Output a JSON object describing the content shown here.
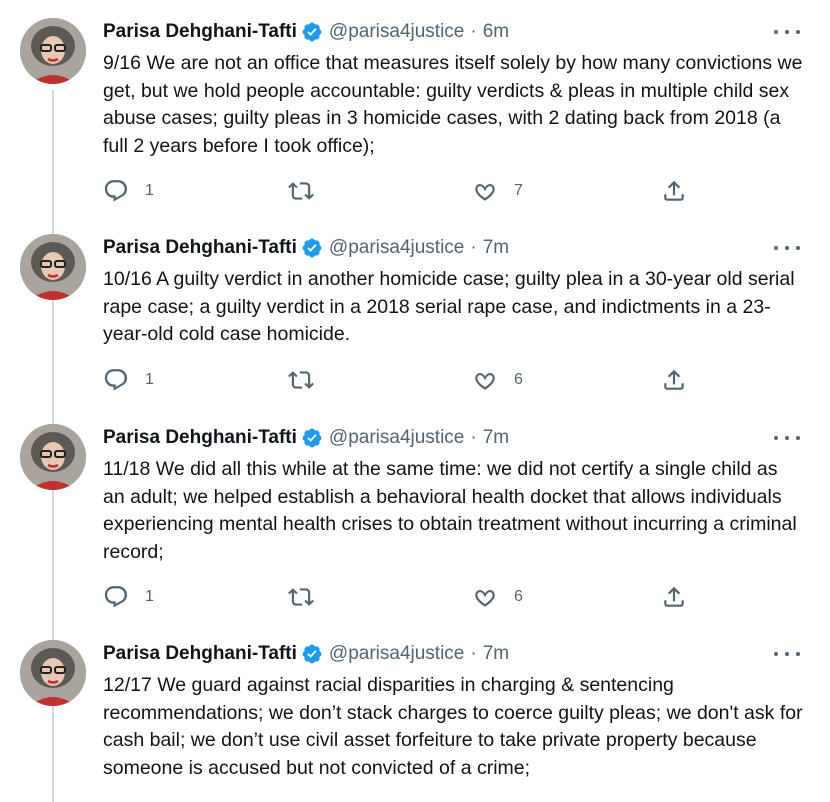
{
  "author": {
    "name": "Parisa Dehghani-Tafti",
    "handle": "@parisa4justice",
    "separator": "·"
  },
  "colors": {
    "verified": "#1d9bf0",
    "secondary_text": "#536471",
    "thread_line": "#cfd9de"
  },
  "icons": [
    "verified-badge-icon",
    "more-icon",
    "reply-icon",
    "retweet-icon",
    "like-icon",
    "share-icon"
  ],
  "tweets": [
    {
      "time": "6m",
      "text": "9/16 We are not an office that measures itself solely by how many convictions we get, but we hold people accountable: guilty verdicts & pleas in multiple child sex abuse cases; guilty pleas in 3 homicide cases, with 2 dating back from 2018 (a full 2 years before I took office);",
      "replies": "1",
      "retweets": "",
      "likes": "7"
    },
    {
      "time": "7m",
      "text": "10/16 A guilty verdict in another homicide case; guilty plea in a 30-year old serial rape case; a guilty verdict in a 2018 serial rape case, and indictments in a 23-year-old cold case homicide.",
      "replies": "1",
      "retweets": "",
      "likes": "6"
    },
    {
      "time": "7m",
      "text": "11/18 We did all this while at the same time: we did not certify a single child as an adult; we helped establish a behavioral health docket that allows individuals experiencing mental health crises to obtain treatment without incurring a criminal record;",
      "replies": "1",
      "retweets": "",
      "likes": "6"
    },
    {
      "time": "7m",
      "text": "12/17 We guard against racial disparities in charging & sentencing recommendations; we don’t stack charges to coerce guilty pleas; we don't ask for cash bail; we don’t use civil asset forfeiture to take private property because someone is accused but not convicted of a crime;"
    }
  ]
}
